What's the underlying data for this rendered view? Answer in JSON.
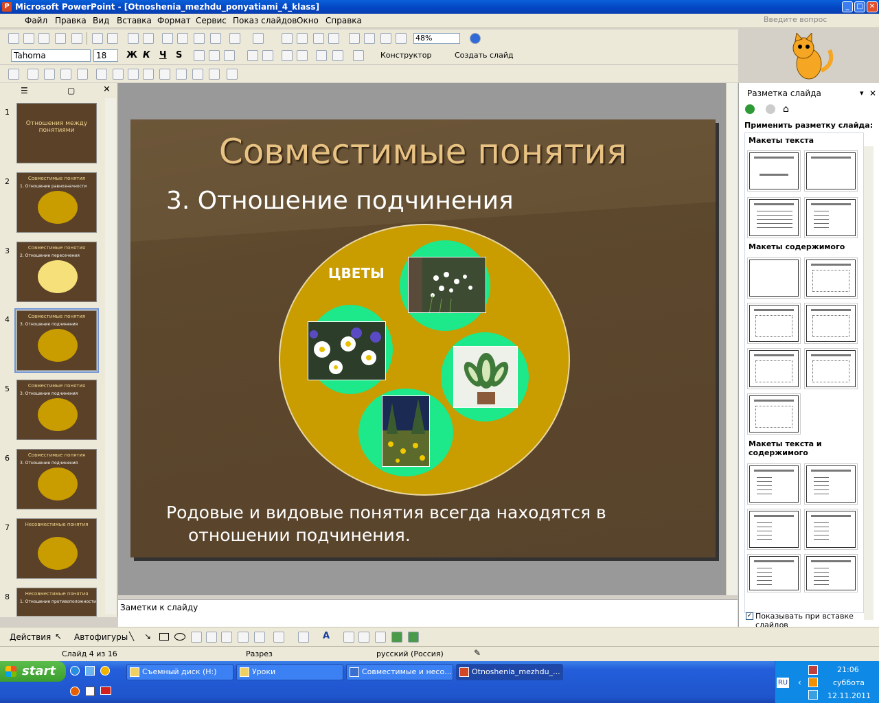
{
  "window": {
    "title": "Microsoft PowerPoint - [Otnoshenia_mezhdu_ponyatiami_4_klass]"
  },
  "menu": {
    "items": [
      "Файл",
      "Правка",
      "Вид",
      "Вставка",
      "Формат",
      "Сервис",
      "Показ слайдов",
      "Окно",
      "Справка"
    ],
    "ask_placeholder": "Введите вопрос"
  },
  "toolbar": {
    "zoom": "48%",
    "font": "Tahoma",
    "size": "18",
    "bold": "Ж",
    "italic": "К",
    "underline": "Ч",
    "shadow": "S",
    "designer": "Конструктор",
    "new_slide": "Создать слайд"
  },
  "thumbnails": [
    {
      "num": "1",
      "title": "Отношения между понятиями",
      "sub": ""
    },
    {
      "num": "2",
      "title": "Совместимые понятия",
      "sub": "1. Отношение равнозначности"
    },
    {
      "num": "3",
      "title": "Совместимые понятия",
      "sub": "2. Отношение пересечения"
    },
    {
      "num": "4",
      "title": "Совместимые понятия",
      "sub": "3. Отношение подчинения"
    },
    {
      "num": "5",
      "title": "Совместимые понятия",
      "sub": "3. Отношение подчинения"
    },
    {
      "num": "6",
      "title": "Совместимые понятия",
      "sub": "3. Отношение подчинения"
    },
    {
      "num": "7",
      "title": "Несовместимые понятия",
      "sub": ""
    },
    {
      "num": "8",
      "title": "Несовместимые понятия",
      "sub": "1. Отношение противоположности"
    }
  ],
  "slide": {
    "title": "Совместимые понятия",
    "subtitle": "3. Отношение подчинения",
    "label": "ЦВЕТЫ",
    "body": "Родовые и видовые понятия всегда находятся в отношении подчинения."
  },
  "notes": {
    "placeholder": "Заметки к слайду"
  },
  "taskpane": {
    "title": "Разметка слайда",
    "apply_label": "Применить разметку слайда:",
    "sec_text": "Макеты текста",
    "sec_content": "Макеты содержимого",
    "sec_text_content": "Макеты текста и содержимого",
    "show_on_insert": "Показывать при вставке слайдов"
  },
  "drawbar": {
    "actions": "Действия",
    "autoshapes": "Автофигуры"
  },
  "status": {
    "slide": "Слайд 4 из 16",
    "design": "Разрез",
    "lang": "русский (Россия)"
  },
  "taskbar": {
    "start": "start",
    "tasks": [
      "Съемный диск (H:)",
      "Уроки",
      "Совместимые и несо...",
      "Otnoshenia_mezhdu_..."
    ],
    "lang": "RU",
    "time": "21:06",
    "day": "суббота",
    "date": "12.11.2011"
  }
}
